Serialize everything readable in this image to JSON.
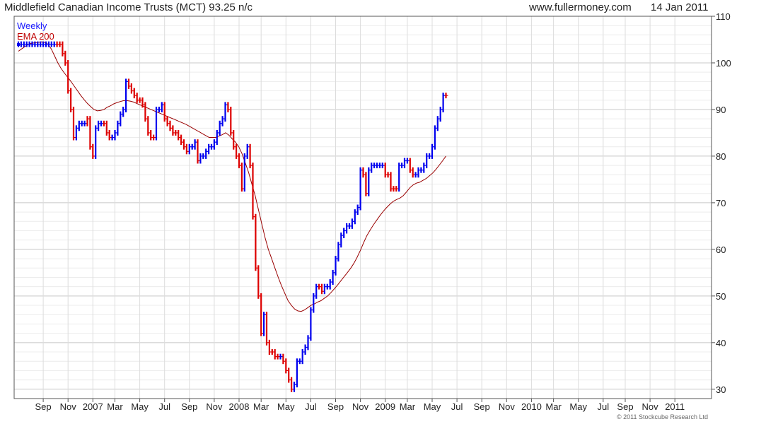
{
  "header": {
    "title": "Middlefield Canadian Income Trusts (MCT) 93.25 n/c",
    "website": "www.fullermoney.com",
    "date": "14 Jan 2011"
  },
  "legend": {
    "weekly": "Weekly",
    "ema": "EMA 200"
  },
  "copyright": "© 2011 Stockcube Research Ltd",
  "colors": {
    "up": "#0000ee",
    "down": "#dd0000",
    "ema": "#990000",
    "grid": "#d8d8d8"
  },
  "chart_data": {
    "type": "line",
    "title": "Middlefield Canadian Income Trusts (MCT) 93.25 n/c",
    "frequency": "Weekly",
    "ylim": [
      28,
      110
    ],
    "yticks": [
      30,
      40,
      50,
      60,
      70,
      80,
      90,
      100,
      110
    ],
    "x_tick_labels": [
      "Sep",
      "Nov",
      "2007",
      "Mar",
      "May",
      "Jul",
      "Sep",
      "Nov",
      "2008",
      "Mar",
      "May",
      "Jul",
      "Sep",
      "Nov",
      "2009",
      "Mar",
      "May",
      "Jul",
      "Sep",
      "Nov",
      "2010",
      "Mar",
      "May",
      "Jul",
      "Sep",
      "Nov",
      "2011"
    ],
    "x_tick_weeks": [
      9,
      18,
      27,
      35,
      44,
      53,
      62,
      71,
      80,
      88,
      97,
      106,
      115,
      124,
      133,
      141,
      150,
      159,
      168,
      177,
      186,
      194,
      203,
      212,
      220,
      229,
      238
    ],
    "weekly_close": [
      104,
      104,
      104,
      104,
      104,
      104,
      104,
      104,
      104,
      104,
      104,
      104,
      104,
      104,
      104,
      104,
      102,
      100,
      94,
      90,
      84,
      86,
      87,
      87,
      87,
      88,
      82,
      80,
      86,
      87,
      87,
      87,
      85,
      84,
      84,
      85,
      87,
      89,
      90,
      96,
      95,
      94,
      93,
      92,
      92,
      91,
      88,
      85,
      84,
      84,
      90,
      90,
      91,
      88,
      87,
      86,
      85,
      85,
      84,
      83,
      82,
      81,
      82,
      82,
      83,
      79,
      80,
      80,
      81,
      82,
      82,
      83,
      85,
      87,
      88,
      91,
      90,
      85,
      82,
      80,
      78,
      73,
      80,
      82,
      78,
      67,
      56,
      50,
      42,
      46,
      40,
      38,
      38,
      37,
      37,
      37,
      36,
      34,
      32,
      30,
      31,
      36,
      36,
      38,
      39,
      41,
      47,
      50,
      52,
      52,
      51,
      52,
      52,
      53,
      55,
      58,
      61,
      63,
      64,
      65,
      65,
      66,
      68,
      69,
      77,
      76,
      72,
      77,
      78,
      78,
      78,
      78,
      78,
      76,
      76,
      73,
      73,
      73,
      78,
      78,
      79,
      79,
      77,
      76,
      76,
      77,
      77,
      78,
      80,
      80,
      82,
      86,
      88,
      90,
      93,
      93
    ],
    "weekly_type": [
      "u",
      "u",
      "u",
      "u",
      "u",
      "u",
      "u",
      "u",
      "u",
      "u",
      "u",
      "u",
      "u",
      "u",
      "d",
      "d",
      "d",
      "d",
      "d",
      "d",
      "d",
      "u",
      "u",
      "u",
      "u",
      "d",
      "d",
      "d",
      "u",
      "u",
      "u",
      "d",
      "d",
      "d",
      "u",
      "u",
      "u",
      "u",
      "u",
      "u",
      "d",
      "d",
      "d",
      "d",
      "d",
      "d",
      "d",
      "d",
      "d",
      "d",
      "u",
      "u",
      "u",
      "d",
      "d",
      "d",
      "d",
      "d",
      "d",
      "d",
      "d",
      "d",
      "u",
      "u",
      "u",
      "d",
      "u",
      "u",
      "u",
      "u",
      "u",
      "u",
      "u",
      "u",
      "u",
      "u",
      "d",
      "d",
      "d",
      "d",
      "d",
      "d",
      "u",
      "u",
      "d",
      "d",
      "d",
      "d",
      "d",
      "u",
      "d",
      "d",
      "d",
      "d",
      "d",
      "u",
      "d",
      "d",
      "d",
      "d",
      "u",
      "u",
      "u",
      "u",
      "u",
      "u",
      "u",
      "u",
      "u",
      "d",
      "d",
      "u",
      "u",
      "u",
      "u",
      "u",
      "u",
      "u",
      "u",
      "u",
      "u",
      "u",
      "u",
      "u",
      "u",
      "d",
      "d",
      "u",
      "u",
      "u",
      "u",
      "u",
      "u",
      "d",
      "d",
      "d",
      "d",
      "d",
      "u",
      "u",
      "u",
      "u",
      "d",
      "d",
      "u",
      "u",
      "u",
      "u",
      "u",
      "u",
      "u",
      "u",
      "u",
      "u",
      "u",
      "d"
    ],
    "ema_200": [
      102.5,
      103,
      103.5,
      104,
      104.2,
      104.3,
      104.4,
      104.5,
      104.4,
      104,
      103,
      101.5,
      100,
      98.8,
      97.8,
      96.9,
      96,
      95,
      94,
      93,
      92.1,
      91.3,
      90.6,
      90,
      89.7,
      89.8,
      90,
      90.5,
      90.8,
      91.2,
      91.5,
      91.7,
      91.9,
      91.9,
      91.8,
      91.6,
      91.3,
      91,
      90.7,
      90.4,
      90.1,
      89.8,
      89.5,
      89.2,
      88.9,
      88.6,
      88.3,
      88,
      87.7,
      87.4,
      87.1,
      86.8,
      86.4,
      86,
      85.6,
      85.2,
      84.8,
      84.4,
      84,
      84,
      84,
      84.3,
      84.6,
      85,
      84.5,
      83.7,
      83,
      82,
      80.5,
      78.5,
      76.5,
      74,
      71.5,
      68.5,
      65.5,
      62.5,
      60,
      58,
      56,
      54,
      52.2,
      50.6,
      49,
      48,
      47.2,
      46.8,
      46.7,
      47,
      47.5,
      48,
      48.3,
      48.7,
      49,
      49.5,
      50,
      50.7,
      51.5,
      52.3,
      53.2,
      54.1,
      55,
      55.9,
      57,
      58.3,
      59.8,
      61.5,
      63,
      64.2,
      65.3,
      66.3,
      67.3,
      68.2,
      69,
      69.7,
      70.3,
      70.7,
      71,
      71.5,
      72.3,
      73.2,
      73.8,
      74.2,
      74.4,
      74.8,
      75.2,
      75.8,
      76.4,
      77.2,
      78.1,
      79,
      80
    ]
  }
}
